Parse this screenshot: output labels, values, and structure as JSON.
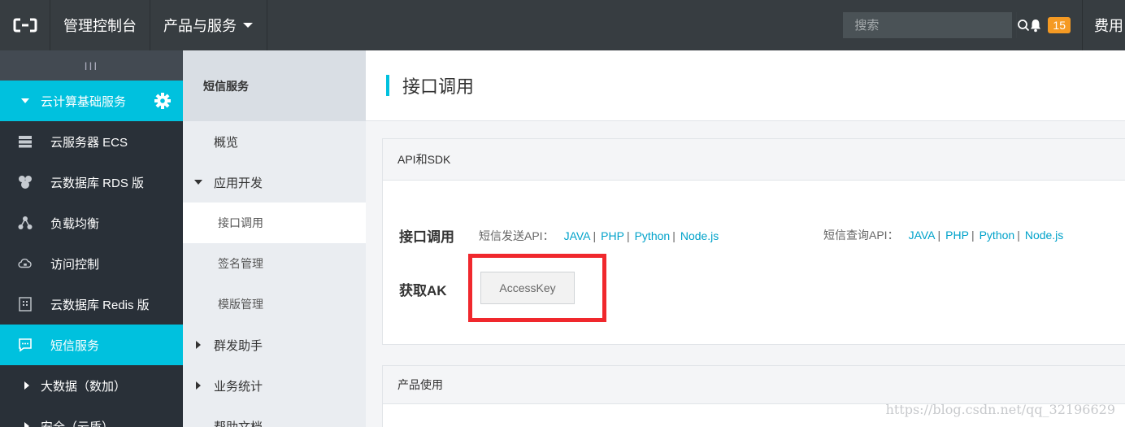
{
  "topbar": {
    "console_label": "管理控制台",
    "products_label": "产品与服务",
    "search_placeholder": "搜索",
    "notification_count": "15",
    "fee_label": "费用"
  },
  "sidebar": {
    "handle": "III",
    "group_label": "云计算基础服务",
    "items": [
      {
        "label": "云服务器 ECS",
        "icon": "server-icon"
      },
      {
        "label": "云数据库 RDS 版",
        "icon": "database-icon"
      },
      {
        "label": "负载均衡",
        "icon": "load-balancer-icon"
      },
      {
        "label": "访问控制",
        "icon": "cloud-lock-icon"
      },
      {
        "label": "云数据库 Redis 版",
        "icon": "redis-icon"
      },
      {
        "label": "短信服务",
        "icon": "message-icon"
      }
    ],
    "sub_groups": [
      {
        "label": "大数据（数加）"
      },
      {
        "label": "安全（云盾）"
      }
    ]
  },
  "subnav": {
    "title": "短信服务",
    "overview": "概览",
    "app_dev": "应用开发",
    "children": [
      "接口调用",
      "签名管理",
      "模版管理"
    ],
    "bulk": "群发助手",
    "stats": "业务统计",
    "help": "帮助文档"
  },
  "main": {
    "page_title": "接口调用",
    "api_panel_title": "API和SDK",
    "api_label": "接口调用",
    "send_api_label": "短信发送API：",
    "query_api_label": "短信查询API：",
    "sdk_links": [
      "JAVA",
      "PHP",
      "Python",
      "Node.js"
    ],
    "separator": "|",
    "ak_label": "获取AK",
    "ak_button": "AccessKey",
    "usage_panel_title": "产品使用"
  },
  "watermark": "https://blog.csdn.net/qq_32196629",
  "colors": {
    "accent": "#00c1de",
    "topbar": "#373d41",
    "sidebar": "#293038",
    "badge": "#f59a23",
    "highlight_box": "#f0282d",
    "link": "#00a2ca"
  }
}
